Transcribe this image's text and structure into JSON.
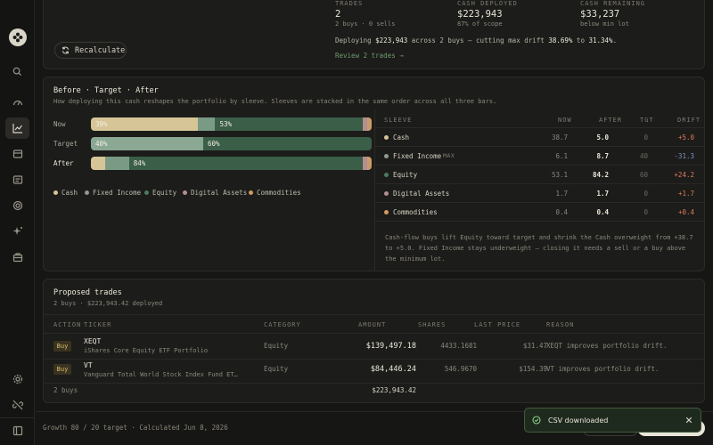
{
  "summary": {
    "trades_label": "TRADES",
    "trades_value": "2",
    "trades_sub": "2 buys · 0 sells",
    "deployed_label": "CASH DEPLOYED",
    "deployed_value": "$223,943",
    "deployed_sub": "87% of scope",
    "remaining_label": "CASH REMAINING",
    "remaining_value": "$33,237",
    "remaining_sub": "below min lot",
    "deploy_text_a": "Deploying ",
    "deploy_amount": "$223,943",
    "deploy_text_b": " across 2 buys — cutting max drift ",
    "drift_from": "38.69%",
    "deploy_text_c": " to ",
    "drift_to": "31.34%",
    "deploy_text_d": ".",
    "review_link": "Review 2 trades →",
    "recalc_label": "Recalculate"
  },
  "bta": {
    "title": "Before · Target · After",
    "subtitle": "How deploying this cash reshapes the portfolio by sleeve. Sleeves are stacked in the same order across all three bars.",
    "rows": [
      {
        "label": "Now",
        "segs": [
          {
            "v": 38.7,
            "c": "#d6c597",
            "t": "39%"
          },
          {
            "v": 6.1,
            "c": "#7a9a86",
            "t": ""
          },
          {
            "v": 53.1,
            "c": "#3b5e48",
            "t": "53%"
          },
          {
            "v": 1.7,
            "c": "#b58e90",
            "t": ""
          },
          {
            "v": 0.4,
            "c": "#c99a6c",
            "t": ""
          }
        ]
      },
      {
        "label": "Target",
        "segs": [
          {
            "v": 40,
            "c": "#8aa894",
            "t": "40%"
          },
          {
            "v": 60,
            "c": "#3b5e48",
            "t": "60%"
          }
        ]
      },
      {
        "label": "After",
        "segs": [
          {
            "v": 5.0,
            "c": "#d6c597",
            "t": ""
          },
          {
            "v": 8.7,
            "c": "#7a9a86",
            "t": ""
          },
          {
            "v": 84.2,
            "c": "#3b5e48",
            "t": "84%"
          },
          {
            "v": 1.7,
            "c": "#b58e90",
            "t": ""
          },
          {
            "v": 0.4,
            "c": "#c99a6c",
            "t": ""
          }
        ]
      }
    ],
    "legend": [
      {
        "name": "Cash",
        "color": "#d6c597"
      },
      {
        "name": "Fixed Income",
        "color": "#8e9a92"
      },
      {
        "name": "Equity",
        "color": "#4f7a5e"
      },
      {
        "name": "Digital Assets",
        "color": "#b58e90"
      },
      {
        "name": "Commodities",
        "color": "#d39a5e"
      }
    ]
  },
  "sleeves": {
    "headers": {
      "sleeve": "SLEEVE",
      "now": "NOW",
      "after": "AFTER",
      "tgt": "TGT",
      "drift": "DRIFT"
    },
    "rows": [
      {
        "name": "Cash",
        "tag": "",
        "color": "#d6c597",
        "now": "38.7",
        "after": "5.0",
        "tgt": "0",
        "drift": "+5.0",
        "drift_color": "#e07a5a"
      },
      {
        "name": "Fixed Income",
        "tag": "MAX",
        "color": "#8e9a92",
        "now": "6.1",
        "after": "8.7",
        "tgt": "40",
        "drift": "-31.3",
        "drift_color": "#7c93c4"
      },
      {
        "name": "Equity",
        "tag": "",
        "color": "#4f7a5e",
        "now": "53.1",
        "after": "84.2",
        "tgt": "60",
        "drift": "+24.2",
        "drift_color": "#e07a5a"
      },
      {
        "name": "Digital Assets",
        "tag": "",
        "color": "#b58e90",
        "now": "1.7",
        "after": "1.7",
        "tgt": "0",
        "drift": "+1.7",
        "drift_color": "#e07a5a"
      },
      {
        "name": "Commodities",
        "tag": "",
        "color": "#d39a5e",
        "now": "0.4",
        "after": "0.4",
        "tgt": "0",
        "drift": "+0.4",
        "drift_color": "#e07a5a"
      }
    ],
    "note": "Cash-flow buys lift Equity toward target and shrink the Cash overweight from +38.7 to +5.0. Fixed Income stays underweight — closing it needs a sell or a buy above the minimum lot."
  },
  "trades": {
    "title": "Proposed trades",
    "subtitle": "2 buys · $223,943.42 deployed",
    "headers": {
      "action": "ACTION",
      "ticker": "TICKER",
      "category": "CATEGORY",
      "amount": "AMOUNT",
      "shares": "SHARES",
      "price": "LAST PRICE",
      "reason": "REASON"
    },
    "rows": [
      {
        "action": "Buy",
        "ticker": "XEQT",
        "name": "iShares Core Equity ETF Portfolio",
        "category": "Equity",
        "amount": "$139,497.18",
        "shares": "4433.1681",
        "price": "$31.47",
        "reason": "XEQT improves portfolio drift."
      },
      {
        "action": "Buy",
        "ticker": "VT",
        "name": "Vanguard Total World Stock Index Fund ET…",
        "category": "Equity",
        "amount": "$84,446.24",
        "shares": "546.9670",
        "price": "$154.39",
        "reason": "VT improves portfolio drift."
      }
    ],
    "footer_count": "2 buys",
    "footer_total": "$223,943.42"
  },
  "footer": {
    "text": "Growth 80 / 20 target · Calculated Jun 8, 2026"
  },
  "toast": {
    "text": "CSV downloaded"
  }
}
